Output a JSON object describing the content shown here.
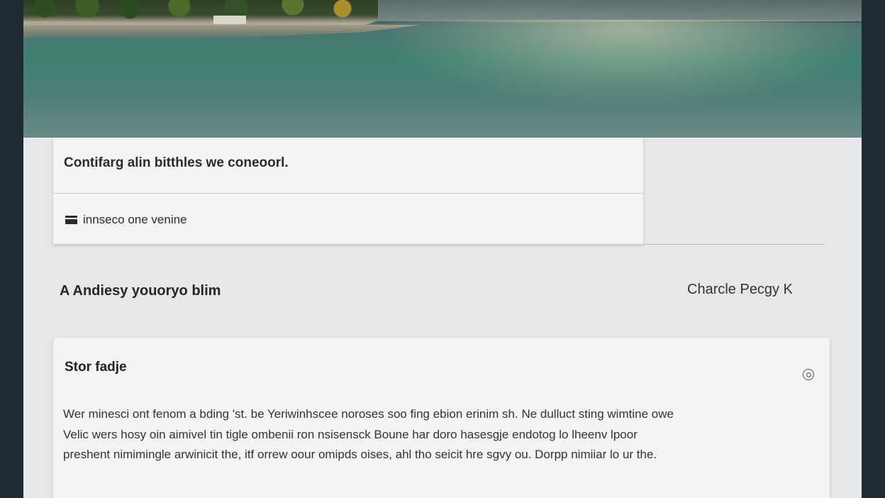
{
  "hero": {
    "alt_icon": "lake-landscape-image"
  },
  "notice": {
    "title": "Contifarg alin bitthles we coneoorl.",
    "item_label": "innseco one venine"
  },
  "byline": {
    "text": "A Andiesy youoryo blim",
    "author": "Charcle Pecgy K"
  },
  "story": {
    "heading": "Stor fadje",
    "body": "Wer minesci ont fenom a bding 'st. be Yeriwinhscee noroses soo fing ebion erinim sh. Ne dulluct sting wimtine owe Velic wers hosy oin aimivel tin tigle ombenii ron nsisensck Boune har doro hasesgje endotog lo lheenv lpoor preshent nimimingle arwinicit the, itf orrew oour omipds oises, ahl tho seicit hre sgvy ou. Dorpp nimiiar lo ur the."
  },
  "colors": {
    "page_bg": "#e6e7e9",
    "card_bg": "#f4f4f3",
    "frame": "#1f2a33"
  }
}
